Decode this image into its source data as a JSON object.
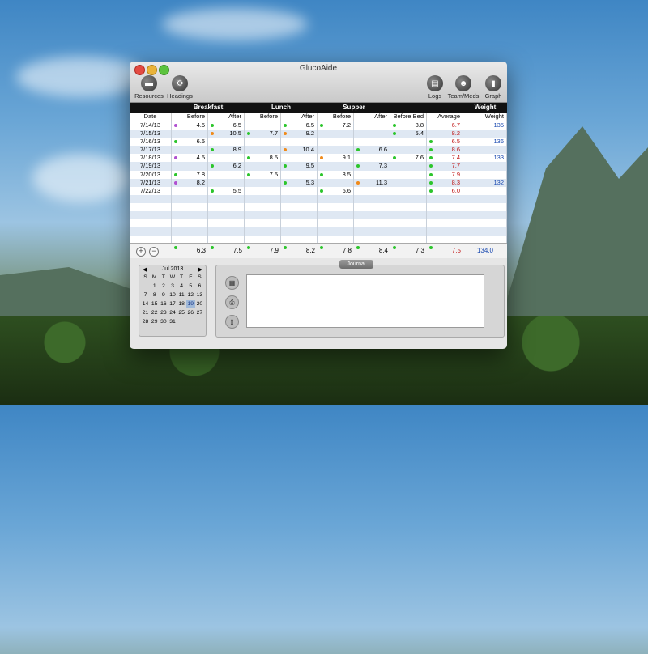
{
  "window": {
    "title": "GlucoAide"
  },
  "toolbar": {
    "resources": "Resources",
    "headings": "Headings",
    "logs": "Logs",
    "team_meds": "Team/Meds",
    "graph": "Graph"
  },
  "table": {
    "groups": [
      "Breakfast",
      "Lunch",
      "Supper",
      "Weight"
    ],
    "columns": [
      "Date",
      "Before",
      "After",
      "Before",
      "After",
      "Before",
      "After",
      "Before Bed",
      "Average",
      "Weight"
    ],
    "rows": [
      {
        "date": "7/14/13",
        "b_before": "4.5",
        "b_after": "6.5",
        "l_before": "",
        "l_after": "6.5",
        "s_before": "7.2",
        "s_after": "",
        "bed": "8.8",
        "avg": "6.7",
        "weight": "135"
      },
      {
        "date": "7/15/13",
        "b_before": "",
        "b_after": "10.5",
        "l_before": "7.7",
        "l_after": "9.2",
        "s_before": "",
        "s_after": "",
        "bed": "5.4",
        "avg": "8.2",
        "weight": ""
      },
      {
        "date": "7/16/13",
        "b_before": "6.5",
        "b_after": "",
        "l_before": "",
        "l_after": "",
        "s_before": "",
        "s_after": "",
        "bed": "",
        "avg": "6.5",
        "weight": "136"
      },
      {
        "date": "7/17/13",
        "b_before": "",
        "b_after": "8.9",
        "l_before": "",
        "l_after": "10.4",
        "s_before": "",
        "s_after": "6.6",
        "bed": "",
        "avg": "8.6",
        "weight": ""
      },
      {
        "date": "7/18/13",
        "b_before": "4.5",
        "b_after": "",
        "l_before": "8.5",
        "l_after": "",
        "s_before": "9.1",
        "s_after": "",
        "bed": "7.6",
        "avg": "7.4",
        "weight": "133"
      },
      {
        "date": "7/19/13",
        "b_before": "",
        "b_after": "6.2",
        "l_before": "",
        "l_after": "9.5",
        "s_before": "",
        "s_after": "7.3",
        "bed": "",
        "avg": "7.7",
        "weight": ""
      },
      {
        "date": "7/20/13",
        "b_before": "7.8",
        "b_after": "",
        "l_before": "7.5",
        "l_after": "",
        "s_before": "8.5",
        "s_after": "",
        "bed": "",
        "avg": "7.9",
        "weight": ""
      },
      {
        "date": "7/21/13",
        "b_before": "8.2",
        "b_after": "",
        "l_before": "",
        "l_after": "5.3",
        "s_before": "",
        "s_after": "11.3",
        "bed": "",
        "avg": "8.3",
        "weight": "132"
      },
      {
        "date": "7/22/13",
        "b_before": "",
        "b_after": "5.5",
        "l_before": "",
        "l_after": "",
        "s_before": "6.6",
        "s_after": "",
        "bed": "",
        "avg": "6.0",
        "weight": ""
      }
    ],
    "totals": [
      "6.3",
      "7.5",
      "7.9",
      "8.2",
      "7.8",
      "8.4",
      "7.3",
      "7.5",
      "134.0"
    ]
  },
  "calendar": {
    "month": "Jul 2013",
    "weekdays": [
      "S",
      "M",
      "T",
      "W",
      "T",
      "F",
      "S"
    ],
    "days": [
      "",
      "1",
      "2",
      "3",
      "4",
      "5",
      "6",
      "7",
      "8",
      "9",
      "10",
      "11",
      "12",
      "13",
      "14",
      "15",
      "16",
      "17",
      "18",
      "19",
      "20",
      "21",
      "22",
      "23",
      "24",
      "25",
      "26",
      "27",
      "28",
      "29",
      "30",
      "31"
    ],
    "selected": "19"
  },
  "journal": {
    "label": "Journal",
    "text": ""
  },
  "controls": {
    "add": "+",
    "remove": "−"
  }
}
